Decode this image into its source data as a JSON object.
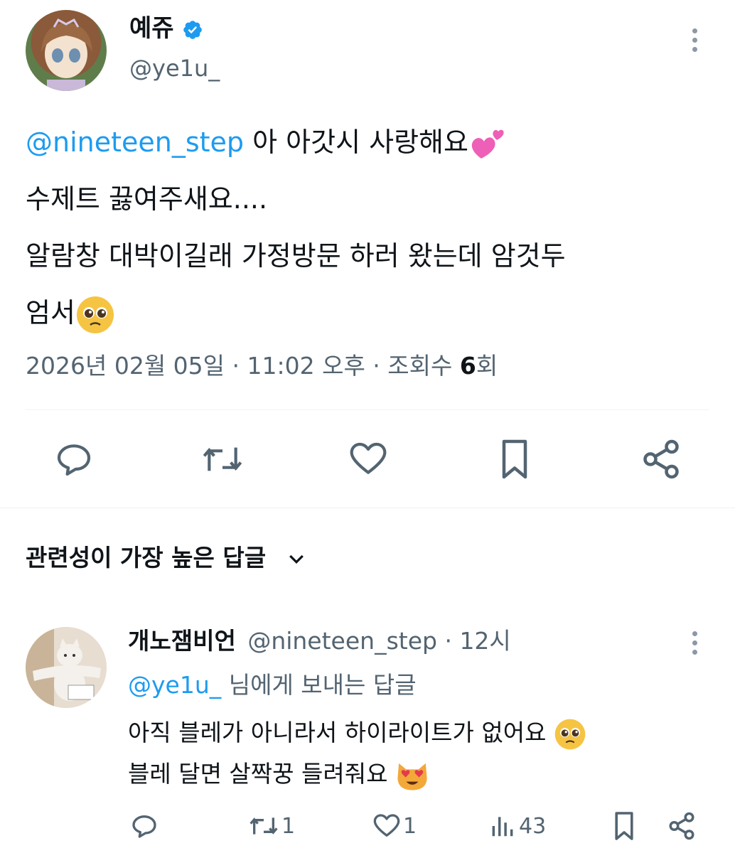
{
  "tweet": {
    "author_name": "예쥬",
    "author_handle": "@ye1u_",
    "mention": "@nineteen_step",
    "line1": " 아 아갓시 사랑해요",
    "line2": "수제트 끓여주새요....",
    "line3": "알람창 대박이길래 가정방문 하러 왔는데 암것두",
    "line4": "엄서",
    "date": "2026년 02월 05일 · 11:02 오후 · 조회수 ",
    "views_count": "6",
    "views_suffix": "회"
  },
  "replies_sort": {
    "label": "관련성이 가장 높은 답글"
  },
  "reply": {
    "author_name": "개노잼비언",
    "author_handle": "@nineteen_step",
    "time": " · 12시",
    "replying_handle": "@ye1u_",
    "replying_suffix": " 님에게 보내는 답글",
    "line1": "아직 블레가 아니라서 하이라이트가 없어요 ",
    "line2": "블레 달면 살짝꿍 들려줘요 ",
    "retweets": "1",
    "likes": "1",
    "views": "43"
  },
  "colors": {
    "link": "#1d9bf0",
    "muted": "#536471",
    "verified": "#1d9bf0"
  },
  "icons": {
    "reply": "speech-bubble-icon",
    "retweet": "retweet-icon",
    "like": "heart-icon",
    "bookmark": "bookmark-icon",
    "share": "share-icon",
    "views": "bar-chart-icon"
  }
}
